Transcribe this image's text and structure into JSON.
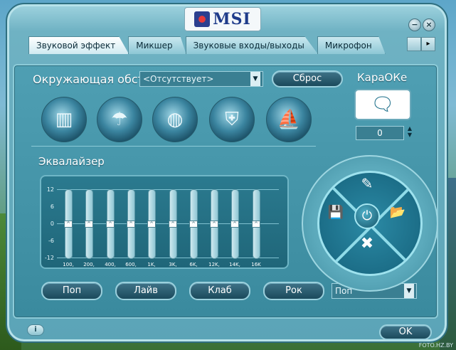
{
  "app": {
    "logo": "MSI"
  },
  "window_controls": {
    "minimize": "−",
    "close": "×"
  },
  "tabs": [
    {
      "label": "Звуковой эффект",
      "active": true
    },
    {
      "label": "Микшер",
      "active": false
    },
    {
      "label": "Звуковые входы/выходы",
      "active": false
    },
    {
      "label": "Микрофон",
      "active": false
    }
  ],
  "tab_scroll": {
    "right": "▸"
  },
  "environment": {
    "label": "Окружающая обст",
    "selected": "<Отсутствует>",
    "reset_label": "Сброс",
    "icons": [
      "hall-icon",
      "shower-icon",
      "sphere-icon",
      "colosseum-icon",
      "opera-icon"
    ]
  },
  "karaoke": {
    "label": "КараОКе",
    "value": "0"
  },
  "equalizer": {
    "label": "Эквалайзер",
    "scale": [
      "12",
      "6",
      "0",
      "-6",
      "-12"
    ],
    "bands": [
      {
        "freq": "100,",
        "value": 0
      },
      {
        "freq": "200,",
        "value": 0
      },
      {
        "freq": "400,",
        "value": 0
      },
      {
        "freq": "600,",
        "value": 0
      },
      {
        "freq": "1K,",
        "value": 0
      },
      {
        "freq": "3K,",
        "value": 0
      },
      {
        "freq": "6K,",
        "value": 0
      },
      {
        "freq": "12K,",
        "value": 0
      },
      {
        "freq": "14K,",
        "value": 0
      },
      {
        "freq": "16K",
        "value": 0
      }
    ],
    "presets": [
      "Поп",
      "Лайв",
      "Клаб",
      "Рок"
    ],
    "preset_selected": "Поп"
  },
  "dial": {
    "center": "⏻",
    "top": "✎",
    "left": "💾",
    "right": "📂",
    "bottom": "✖"
  },
  "footer": {
    "info": "i",
    "ok": "OK"
  },
  "watermark": "FOTO.HZ.BY",
  "colors": {
    "accent": "#1c6e88",
    "panel": "#4f9fb3",
    "button": "#1b4a5c"
  }
}
